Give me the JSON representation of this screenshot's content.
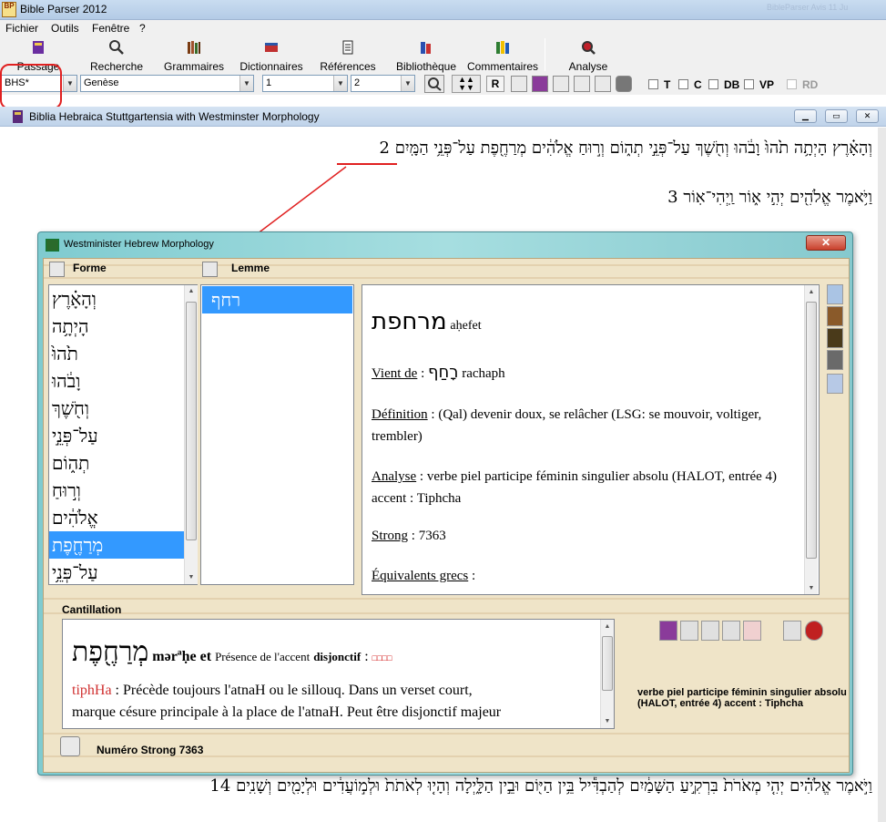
{
  "app": {
    "logo_text": "BP",
    "title": "Bible Parser 2012",
    "title_right": "BibleParser Avis 11 Ju"
  },
  "menu": [
    "Fichier",
    "Outils",
    "Fenêtre",
    "?"
  ],
  "toolbar": [
    {
      "label": "Passage",
      "icon": "book-icon"
    },
    {
      "label": "Recherche",
      "icon": "search-icon"
    },
    {
      "label": "Grammaires",
      "icon": "books-icon"
    },
    {
      "label": "Dictionnaires",
      "icon": "dictionary-icon"
    },
    {
      "label": "Références",
      "icon": "references-icon"
    },
    {
      "label": "Bibliothèque",
      "icon": "library-icon"
    },
    {
      "label": "Commentaires",
      "icon": "commentaries-icon"
    },
    {
      "label": "Analyse",
      "icon": "analyse-icon"
    }
  ],
  "nav": {
    "version": "BHS*",
    "book": "Genèse",
    "chapter": "1",
    "verse": "2",
    "r_button": "R",
    "checks": [
      "T",
      "C",
      "DB",
      "VP",
      "RD"
    ]
  },
  "child_window": {
    "title": "Biblia Hebraica Stuttgartensia with Westminster Morphology"
  },
  "verses": [
    {
      "num": "2",
      "text": "וְהָאָ֗רֶץ הָיְתָ֥ה תֹ֙הוּ֙ וָבֹ֔הוּ וְחֹ֖שֶׁךְ עַל־פְּנֵ֣י תְה֑וֹם וְר֣וּחַ אֱלֹהִ֔ים מְרַחֶ֖פֶת עַל־פְּנֵ֥י הַמָּֽיִם"
    },
    {
      "num": "3",
      "text": "וַיֹּ֥אמֶר אֱלֹהִ֖ים יְהִ֣י א֑וֹר וַֽיְהִי־אֽוֹר"
    },
    {
      "num": "14",
      "text": "וַיֹּ֣אמֶר אֱלֹהִ֗ים יְהִ֤י מְאֹרֹת֙ בִּרְקִ֣יעַ הַשָּׁמַ֔יִם לְהַבְדִּ֕יל בֵּ֥ין הַיּ֖וֹם וּבֵ֣ין הַלָּ֑יְלָה וְהָי֤וּ לְאֹתֹת֙ וּלְמ֣וֹעֲדִ֔ים וּלְיָמִ֖ים וְשָׁנִֽים"
    }
  ],
  "popup": {
    "title": "Westminister Hebrew Morphology",
    "close_label": "✕",
    "forme_header": "Forme",
    "lemme_header": "Lemme",
    "formes": [
      "וְהָאָ֗רֶץ",
      "הָיְתָ֥ה",
      "תֹ֙הוּ֙",
      "וָבֹ֔הוּ",
      "וְחֹ֖שֶׁךְ",
      "עַל־פְּנֵ֣י",
      "תְה֑וֹם",
      "וְר֣וּחַ",
      "אֱלֹהִ֔ים",
      "מְרַחֶ֖פֶת",
      "עַל־פְּנֵ֥י"
    ],
    "selected_forme": 9,
    "lemme": "רחף",
    "detail": {
      "word": "מרחפת",
      "translit": "aḥefet",
      "vient_de_label": "Vient de",
      "vient_de_word": "רָחַף",
      "vient_de_translit": "rachaph",
      "definition_label": "Définition",
      "definition": "(Qal) devenir doux, se relâcher (LSG: se mouvoir, voltiger, trembler)",
      "analyse_label": "Analyse",
      "analyse": "verbe piel participe féminin singulier absolu (HALOT, entrée 4) accent : Tiphcha",
      "strong_label": "Strong",
      "strong": "7363",
      "greek_label": "Équivalents grecs"
    },
    "cantillation": {
      "label": "Cantillation",
      "word": "מְרַחֶ֖פֶת",
      "translit": "mərªḥe et",
      "presence_text": "Présence de l'accent",
      "disjonctif": "disjonctif",
      "accent_symbol": "□□□□",
      "accent_name": "tiphHa",
      "desc_line1": ": Précède toujours l'atnaH ou le sillouq. Dans un verset court,",
      "desc_line2": "marque césure principale à la place de l'atnaH. Peut être disjonctif majeur"
    },
    "analysis_small": "verbe piel participe féminin singulier absolu      (HALOT, entrée 4)  accent : Tiphcha",
    "strong_footer": "Numéro Strong  7363"
  }
}
